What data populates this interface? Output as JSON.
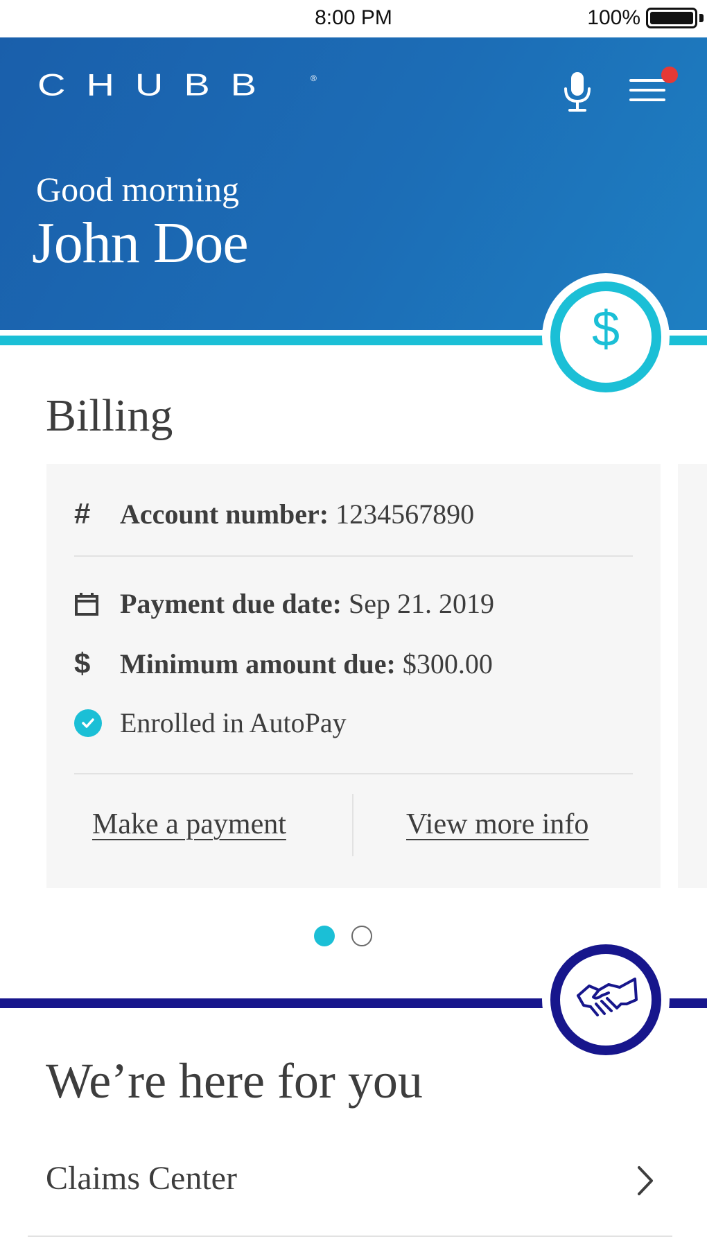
{
  "status_bar": {
    "time": "8:00 PM",
    "battery_percent": "100%",
    "battery_level": 1.0
  },
  "header": {
    "logo_text": "CHUBB",
    "logo_mark": "®",
    "greeting": "Good morning",
    "user_name": "John Doe",
    "icons": [
      "microphone-icon",
      "hamburger-menu-icon"
    ],
    "notification_dot_color": "#e53935"
  },
  "billing": {
    "icon": "dollar-icon",
    "icon_glyph": "$",
    "accent_color": "#1bbfd6",
    "title": "Billing",
    "card": {
      "account_number_label": "Account number:",
      "account_number_value": "1234567890",
      "due_date_label": "Payment due date:",
      "due_date_value": "Sep 21. 2019",
      "min_due_label": "Minimum amount due:",
      "min_due_value": "$300.00",
      "autopay_text": "Enrolled in AutoPay",
      "make_payment_label": "Make a payment",
      "view_more_label": "View more info"
    },
    "pagination": {
      "current": 1,
      "total": 2
    }
  },
  "support": {
    "icon": "handshake-icon",
    "accent_color": "#17168c",
    "title": "We’re here for you",
    "items": [
      {
        "label": "Claims Center"
      }
    ]
  },
  "colors": {
    "header_blue": "#1c6db6",
    "teal": "#1bbfd6",
    "navy": "#17168c",
    "card_bg": "#f6f6f6",
    "text": "#3d3d3d"
  }
}
